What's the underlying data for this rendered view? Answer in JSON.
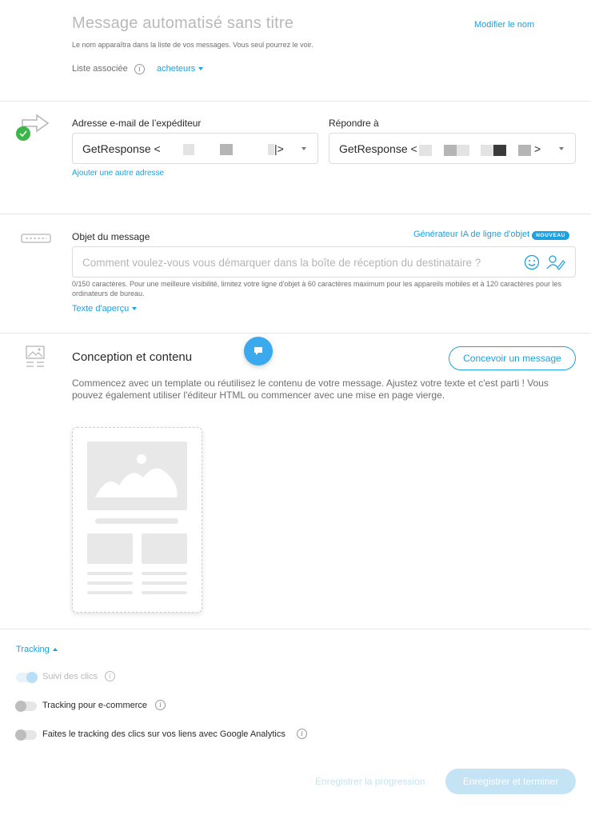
{
  "header": {
    "title": "Message automatisé sans titre",
    "rename_link": "Modifier le nom",
    "hint": "Le nom apparaîtra dans la liste de vos messages. Vous seul pourrez le voir.",
    "list_label": "Liste associée",
    "list_value": "acheteurs"
  },
  "sender": {
    "from_label": "Adresse e-mail de l’expéditeur",
    "from_value_prefix": "GetResponse <",
    "from_value_suffix": "|>",
    "add_address_link": "Ajouter une autre adresse",
    "reply_label": "Répondre à",
    "reply_value_prefix": "GetResponse <",
    "reply_value_suffix": ">"
  },
  "subject": {
    "label": "Objet du message",
    "ai_link": "Générateur IA de ligne d'objet",
    "ai_badge": "NOUVEAU",
    "placeholder": "Comment voulez-vous vous démarquer dans la boîte de réception du destinataire ?",
    "help": "0/150 caractères. Pour une meilleure visibilité, limitez votre ligne d'objet à 60 caractères maximum pour les appareils mobiles et à 120 caractères pour les ordinateurs de bureau.",
    "preview_link": "Texte d'aperçu"
  },
  "design": {
    "title": "Conception et contenu",
    "button": "Concevoir un message",
    "description": "Commencez avec un template ou réutilisez le contenu de votre message. Ajustez votre texte et c'est parti ! Vous pouvez également utiliser l'éditeur HTML ou commencer avec une mise en page vierge."
  },
  "tracking": {
    "toggle_label": "Tracking",
    "options": [
      {
        "label": "Suivi des clics",
        "on": true
      },
      {
        "label": "Tracking pour e-commerce",
        "on": false
      },
      {
        "label": "Faites le tracking des clics sur vos liens avec Google Analytics",
        "on": false
      }
    ]
  },
  "footer": {
    "save_progress": "Enregistrer la progression",
    "save_finish": "Enregistrer et terminer"
  },
  "colors": {
    "accent": "#1da1e0",
    "status_ok": "#3cb54a"
  }
}
